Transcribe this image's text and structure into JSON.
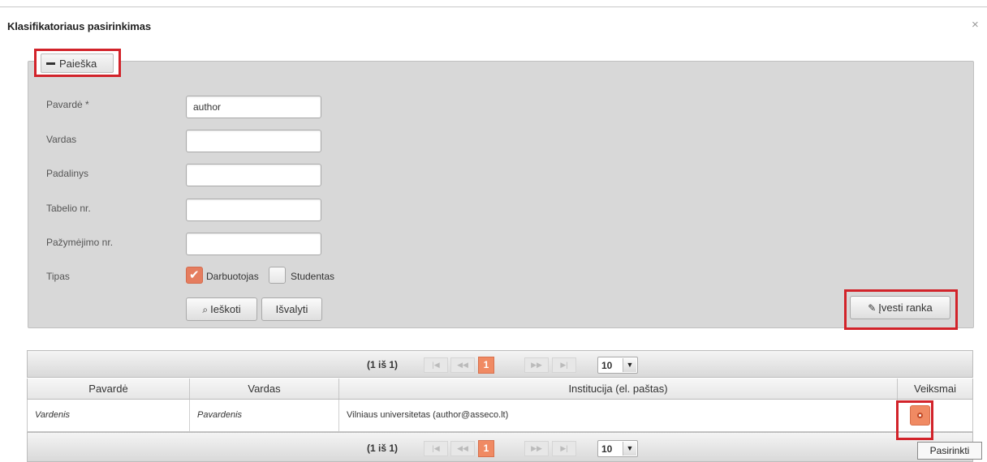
{
  "dialog": {
    "title": "Klasifikatoriaus pasirinkimas",
    "close_symbol": "×"
  },
  "search": {
    "legend": "Paieška",
    "fields": [
      {
        "label": "Pavardė *",
        "value": "author",
        "placeholder": ""
      },
      {
        "label": "Vardas",
        "value": "",
        "placeholder": ""
      },
      {
        "label": "Padalinys",
        "value": "",
        "placeholder": ""
      },
      {
        "label": "Tabelio nr.",
        "value": "",
        "placeholder": ""
      },
      {
        "label": "Pažymėjimo nr.",
        "value": "",
        "placeholder": ""
      }
    ],
    "type_label": "Tipas",
    "type_options": [
      {
        "label": "Darbuotojas",
        "checked": true
      },
      {
        "label": "Studentas",
        "checked": false
      }
    ],
    "search_button": "Ieškoti",
    "clear_button": "Išvalyti",
    "manual_button": "Įvesti ranka"
  },
  "results": {
    "pager": {
      "summary": "(1 iš 1)",
      "first": "|◀",
      "prev": "◀◀",
      "current_page": "1",
      "next": "▶▶",
      "last": "▶|",
      "rows_per_page": "10"
    },
    "columns": [
      "Pavardė",
      "Vardas",
      "Institucija (el. paštas)",
      "Veiksmai"
    ],
    "rows": [
      {
        "surname": "Vardenis",
        "name": "Pavardenis",
        "institution": "Vilniaus universitetas (author@asseco.lt)"
      }
    ],
    "action_tooltip": "Pasirinkti"
  },
  "colors": {
    "accent": "#f08a63",
    "highlight_frame": "#d2232a",
    "panel_bg": "#d8d8d8"
  }
}
